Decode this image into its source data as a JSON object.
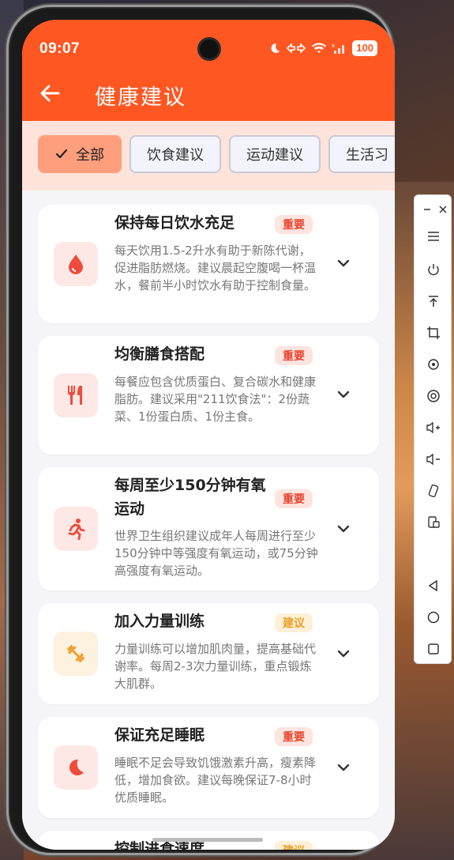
{
  "status": {
    "time": "09:07",
    "battery": "100"
  },
  "header": {
    "title": "健康建议",
    "back_icon": "arrow-left-icon"
  },
  "tabs": [
    {
      "label": "全部",
      "active": true
    },
    {
      "label": "饮食建议",
      "active": false
    },
    {
      "label": "运动建议",
      "active": false
    },
    {
      "label": "生活习",
      "active": false
    }
  ],
  "cards": [
    {
      "title": "保持每日饮水充足",
      "badge": "重要",
      "badge_type": "important",
      "icon": "water-drop-icon",
      "icon_color": "#ef4b3c",
      "icon_bg": "#fde8e5",
      "desc": "每天饮用1.5-2升水有助于新陈代谢，促进脂肪燃烧。建议晨起空腹喝一杯温水，餐前半小时饮水有助于控制食量。"
    },
    {
      "title": "均衡膳食搭配",
      "badge": "重要",
      "badge_type": "important",
      "icon": "utensils-icon",
      "icon_color": "#ef4b3c",
      "icon_bg": "#fde8e5",
      "desc": "每餐应包含优质蛋白、复合碳水和健康脂肪。建议采用\"211饮食法\"：2份蔬菜、1份蛋白质、1份主食。"
    },
    {
      "title_line1": "每周至少150分钟有氧",
      "title_line2": "运动",
      "badge": "重要",
      "badge_type": "important",
      "icon": "running-icon",
      "icon_color": "#ef4b3c",
      "icon_bg": "#fde8e5",
      "desc": "世界卫生组织建议成年人每周进行至少150分钟中等强度有氧运动，或75分钟高强度有氧运动。"
    },
    {
      "title": "加入力量训练",
      "badge": "建议",
      "badge_type": "suggest",
      "icon": "dumbbell-icon",
      "icon_color": "#f0a030",
      "icon_bg": "#fdf1df",
      "desc": "力量训练可以增加肌肉量，提高基础代谢率。每周2-3次力量训练，重点锻炼大肌群。"
    },
    {
      "title": "保证充足睡眠",
      "badge": "重要",
      "badge_type": "important",
      "icon": "moon-icon",
      "icon_color": "#ef4b3c",
      "icon_bg": "#fde8e5",
      "desc": "睡眠不足会导致饥饿激素升高，瘦素降低，增加食欲。建议每晚保证7-8小时优质睡眠。"
    },
    {
      "title": "控制进食速度",
      "badge": "建议",
      "badge_type": "suggest"
    }
  ]
}
